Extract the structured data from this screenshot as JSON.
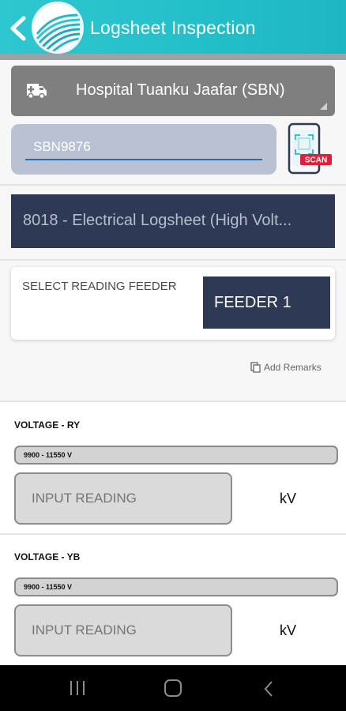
{
  "header": {
    "title": "Logsheet Inspection"
  },
  "hospital": {
    "label": "Hospital Tuanku Jaafar (SBN)"
  },
  "code": {
    "value": "SBN9876"
  },
  "scan": {
    "label": "SCAN"
  },
  "form": {
    "label": "8018 - Electrical Logsheet (High Volt..."
  },
  "feeder": {
    "label": "SELECT READING FEEDER",
    "value": "FEEDER 1"
  },
  "remarks": {
    "label": "Add Remarks"
  },
  "readings": [
    {
      "title": "VOLTAGE - RY",
      "range": "9900 - 11550 V",
      "placeholder": "INPUT READING",
      "unit": "kV"
    },
    {
      "title": "VOLTAGE - YB",
      "range": "9900 - 11550 V",
      "placeholder": "INPUT READING",
      "unit": "kV"
    }
  ],
  "colors": {
    "header": "#2fc7cf",
    "navy": "#2e3a55",
    "input_bg": "#b9c1d3",
    "scan_red": "#e0203a"
  },
  "icons": {
    "back": "chevron-left-icon",
    "ambulance": "ambulance-icon",
    "scan": "qr-scan-icon",
    "remarks": "copy-icon"
  }
}
